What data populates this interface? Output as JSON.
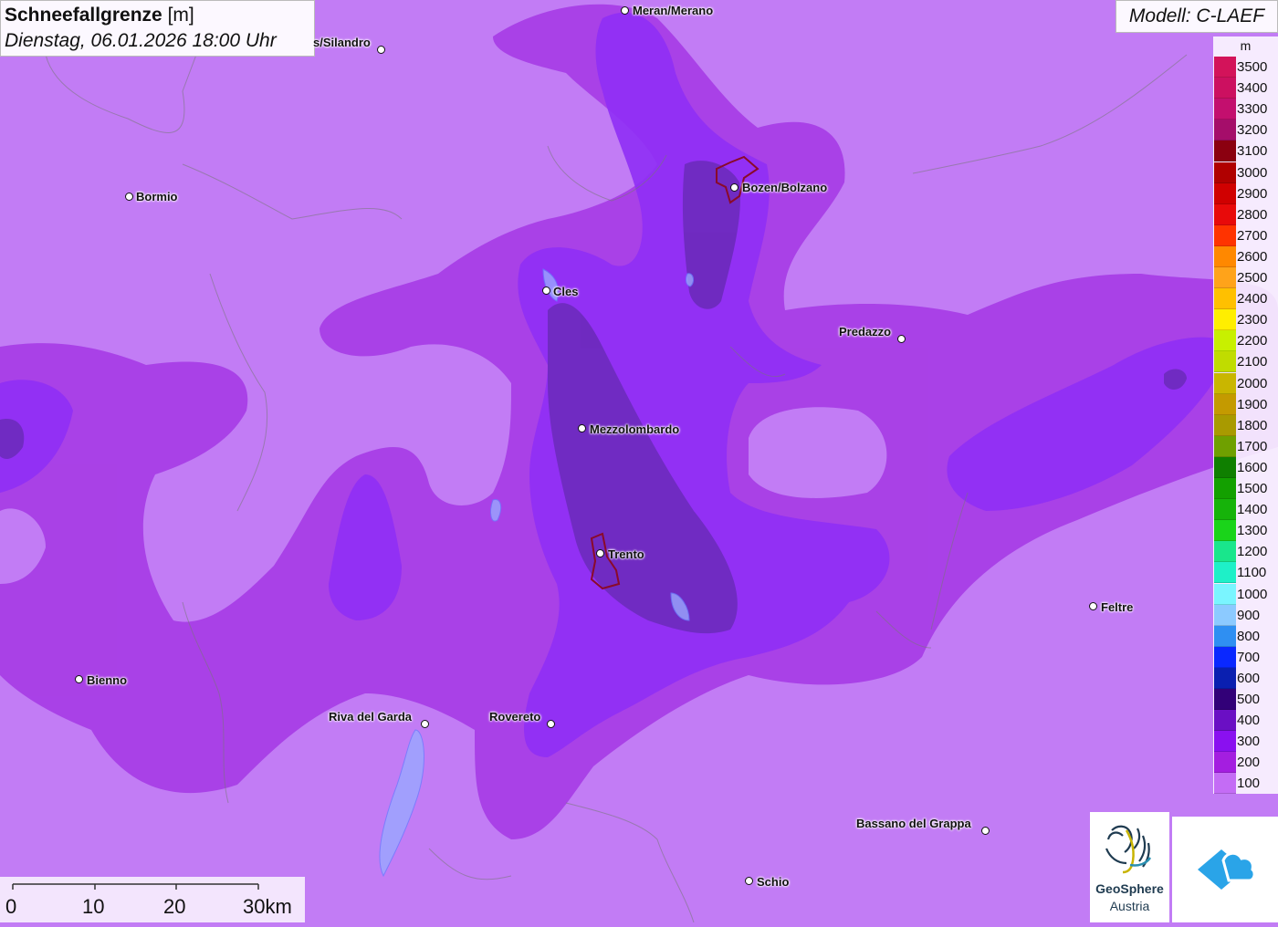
{
  "title": {
    "variable": "Schneefallgrenze",
    "unit": "[m]",
    "datetime": "Dienstag, 06.01.2026 18:00 Uhr"
  },
  "model": "Modell: C-LAEF",
  "legend": {
    "unit": "m",
    "levels": [
      {
        "label": "3500",
        "color": "#d3135a"
      },
      {
        "label": "3400",
        "color": "#cc1060"
      },
      {
        "label": "3300",
        "color": "#c30f6e"
      },
      {
        "label": "3200",
        "color": "#a50d6a"
      },
      {
        "label": "3100",
        "color": "#8b0010"
      },
      {
        "label": "3000",
        "color": "#b00000"
      },
      {
        "label": "2900",
        "color": "#d00000"
      },
      {
        "label": "2800",
        "color": "#e80a0a"
      },
      {
        "label": "2700",
        "color": "#ff3300"
      },
      {
        "label": "2600",
        "color": "#ff8800"
      },
      {
        "label": "2500",
        "color": "#ffa31a"
      },
      {
        "label": "2400",
        "color": "#ffc000"
      },
      {
        "label": "2300",
        "color": "#ffee00"
      },
      {
        "label": "2200",
        "color": "#c8f000"
      },
      {
        "label": "2100",
        "color": "#c0dc00"
      },
      {
        "label": "2000",
        "color": "#c9b600"
      },
      {
        "label": "1900",
        "color": "#c49a00"
      },
      {
        "label": "1800",
        "color": "#a99a00"
      },
      {
        "label": "1700",
        "color": "#6fa000"
      },
      {
        "label": "1600",
        "color": "#0f7f00"
      },
      {
        "label": "1500",
        "color": "#13a000"
      },
      {
        "label": "1400",
        "color": "#16b30a"
      },
      {
        "label": "1300",
        "color": "#1ad41a"
      },
      {
        "label": "1200",
        "color": "#19e68c"
      },
      {
        "label": "1100",
        "color": "#1ef0c8"
      },
      {
        "label": "1000",
        "color": "#7af5ff"
      },
      {
        "label": "900",
        "color": "#8ccaff"
      },
      {
        "label": "800",
        "color": "#2f8ff2"
      },
      {
        "label": "700",
        "color": "#0a28ff"
      },
      {
        "label": "600",
        "color": "#0a1fb0"
      },
      {
        "label": "500",
        "color": "#320078"
      },
      {
        "label": "400",
        "color": "#6a0fc4"
      },
      {
        "label": "300",
        "color": "#8a10f0"
      },
      {
        "label": "200",
        "color": "#a41ee0"
      },
      {
        "label": "100",
        "color": "#c46cf5"
      }
    ]
  },
  "scale": {
    "labels": [
      "0",
      "10",
      "20",
      "30km"
    ]
  },
  "cities": [
    {
      "name": "Meran/Merano"
    },
    {
      "name": "s/Silandro"
    },
    {
      "name": "Bormio"
    },
    {
      "name": "Bozen/Bolzano"
    },
    {
      "name": "Cles"
    },
    {
      "name": "Predazzo"
    },
    {
      "name": "Mezzolombardo"
    },
    {
      "name": "Trento"
    },
    {
      "name": "Feltre"
    },
    {
      "name": "Bienno"
    },
    {
      "name": "Riva del Garda"
    },
    {
      "name": "Rovereto"
    },
    {
      "name": "Bassano del Grappa"
    },
    {
      "name": "Schio"
    }
  ],
  "logos": {
    "geosphere_line1": "GeoSphere",
    "geosphere_line2": "Austria"
  },
  "colors": {
    "base_100": "#c27cf5",
    "zone_200": "#a83ee6",
    "zone_300": "#8f2ff5",
    "zone_400": "#6a2ab8"
  }
}
